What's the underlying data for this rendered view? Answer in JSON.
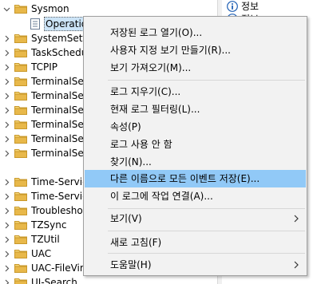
{
  "tree": {
    "items": [
      {
        "label": "Sysmon",
        "expanded": true
      },
      {
        "label": "Operational"
      },
      {
        "label": "SystemSettingsThresholdAdminFlowUI"
      },
      {
        "label": "TaskScheduler"
      },
      {
        "label": "TCPIP"
      },
      {
        "label": "TerminalServices-ClientActiveXCore"
      },
      {
        "label": "TerminalServices-ClientUSBDevices"
      },
      {
        "label": "TerminalServices-LocalSessionManager"
      },
      {
        "label": "TerminalServices-PnPDevices"
      },
      {
        "label": "TerminalServices-Printers"
      },
      {
        "label": "TerminalServices-RemoteConnectionManager"
      },
      {
        "label": "Time-Service"
      },
      {
        "label": "Time-Service-PTP-Provider"
      },
      {
        "label": "Troubleshooting-Recommended"
      },
      {
        "label": "TZSync"
      },
      {
        "label": "TZUtil"
      },
      {
        "label": "UAC"
      },
      {
        "label": "UAC-FileVirtualization"
      },
      {
        "label": "UI-Search"
      }
    ]
  },
  "actions": {
    "items": [
      {
        "label": "정보",
        "icon": "info-icon"
      },
      {
        "label": "정보",
        "icon": "info-icon"
      }
    ]
  },
  "context_menu": {
    "items": [
      {
        "label": "저장된 로그 열기(O)..."
      },
      {
        "label": "사용자 지정 보기 만들기(R)..."
      },
      {
        "label": "보기 가져오기(M)..."
      },
      {
        "label": "로그 지우기(C)..."
      },
      {
        "label": "현재 로그 필터링(L)..."
      },
      {
        "label": "속성(P)"
      },
      {
        "label": "로그 사용 안 함"
      },
      {
        "label": "찾기(N)..."
      },
      {
        "label": "다른 이름으로 모든 이벤트 저장(E)...",
        "highlighted": true
      },
      {
        "label": "이 로그에 작업 연결(A)..."
      },
      {
        "label": "보기(V)",
        "submenu": true
      },
      {
        "label": "새로 고침(F)"
      },
      {
        "label": "도움말(H)",
        "submenu": true
      }
    ]
  },
  "colors": {
    "folder": "#e8b84a",
    "highlight": "#91c9f7",
    "info_icon": "#1e5fb4"
  }
}
